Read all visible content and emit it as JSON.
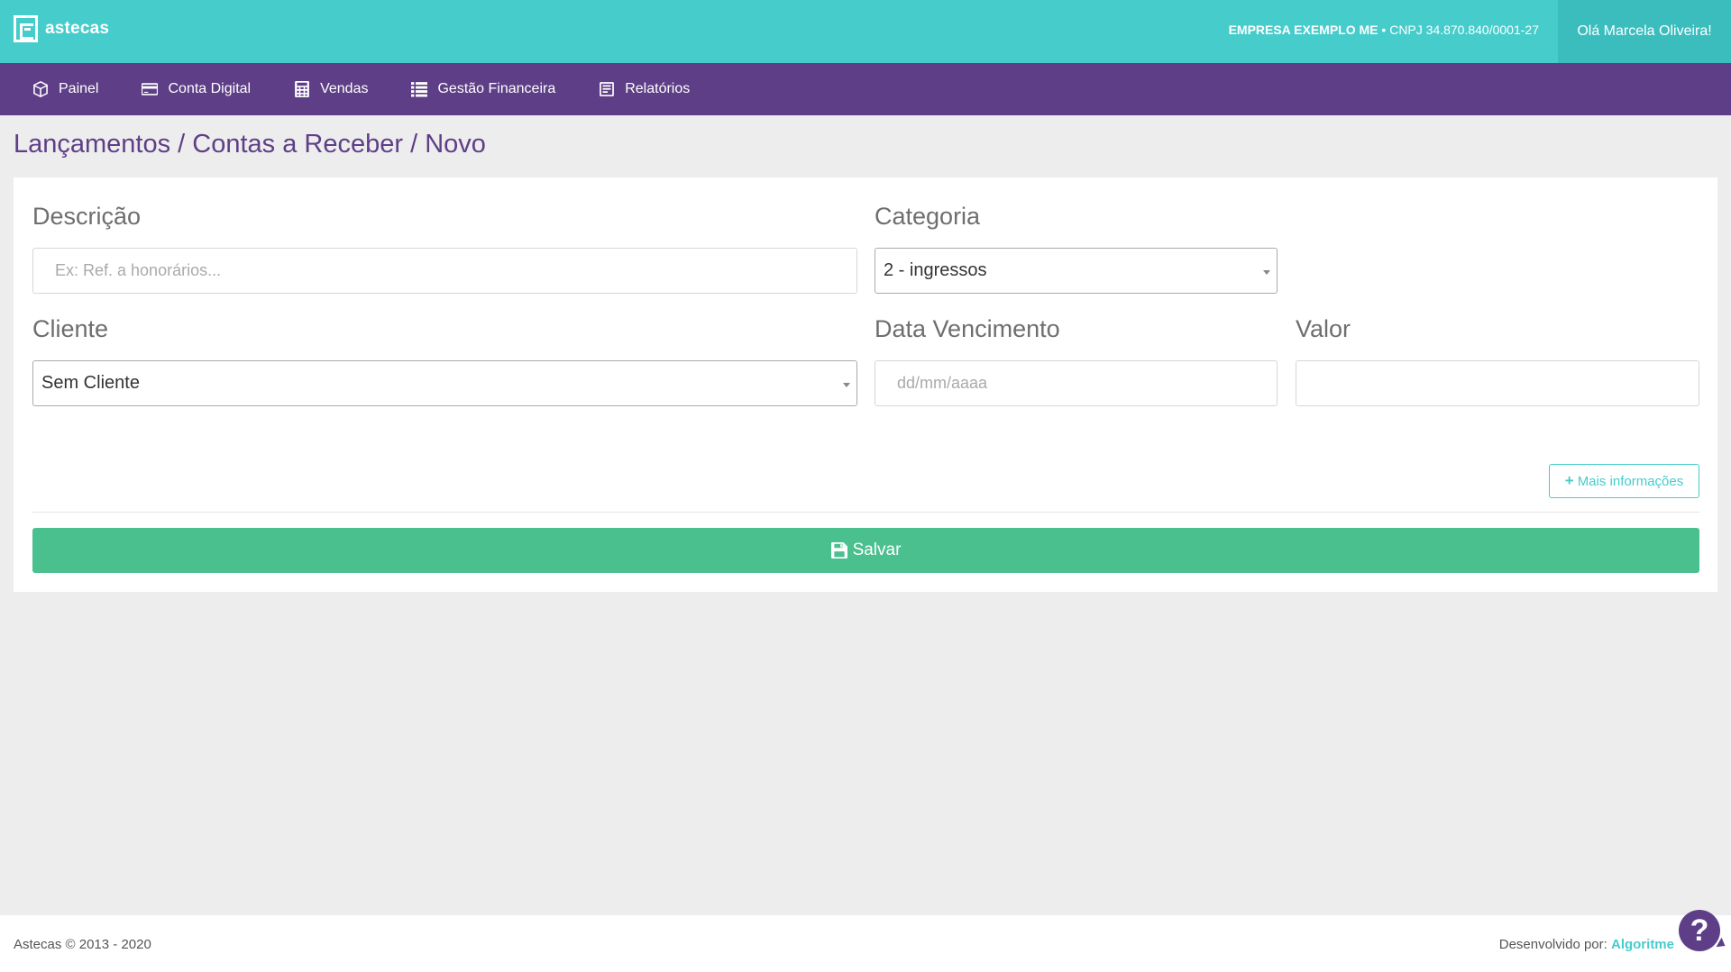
{
  "header": {
    "logo_text": "astecas",
    "company_name": "EMPRESA EXEMPLO ME",
    "company_separator": "•",
    "company_cnpj": "CNPJ 34.870.840/0001-27",
    "greeting": "Olá Marcela Oliveira!"
  },
  "nav": {
    "items": [
      {
        "label": "Painel",
        "icon": "cube-icon"
      },
      {
        "label": "Conta Digital",
        "icon": "credit-card-icon"
      },
      {
        "label": "Vendas",
        "icon": "calculator-icon"
      },
      {
        "label": "Gestão Financeira",
        "icon": "list-icon"
      },
      {
        "label": "Relatórios",
        "icon": "report-icon"
      }
    ]
  },
  "page": {
    "title": "Lançamentos / Contas a Receber / Novo"
  },
  "form": {
    "descricao": {
      "label": "Descrição",
      "value": "",
      "placeholder": "Ex: Ref. a honorários..."
    },
    "categoria": {
      "label": "Categoria",
      "selected": "2 - ingressos"
    },
    "cliente": {
      "label": "Cliente",
      "selected": "Sem Cliente"
    },
    "data_vencimento": {
      "label": "Data Vencimento",
      "value": "",
      "placeholder": "dd/mm/aaaa"
    },
    "valor": {
      "label": "Valor",
      "value": "",
      "placeholder": ""
    },
    "more_info_label": "Mais informações",
    "save_label": "Salvar"
  },
  "footer": {
    "copyright": "Astecas © 2013 - 2020",
    "developed_by": "Desenvolvido por:",
    "developer": "Algoritme",
    "help_label": "?"
  },
  "colors": {
    "header": "#47cccc",
    "nav": "#5e3f87",
    "save_button": "#4bc08f",
    "title": "#5e3f87"
  }
}
